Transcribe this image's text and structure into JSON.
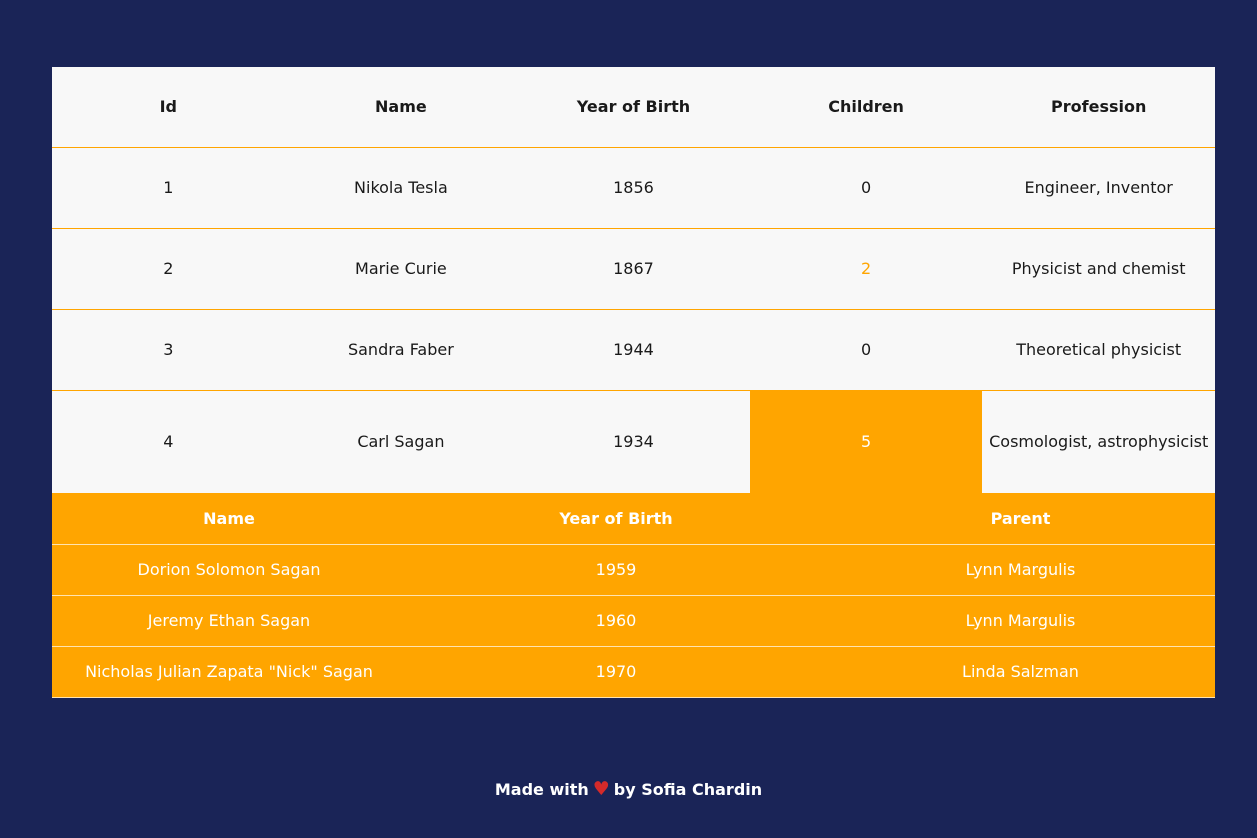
{
  "main_table": {
    "headers": [
      "Id",
      "Name",
      "Year of Birth",
      "Children",
      "Profession"
    ],
    "rows": [
      {
        "id": "1",
        "name": "Nikola Tesla",
        "year": "1856",
        "children": "0",
        "profession": "Engineer, Inventor"
      },
      {
        "id": "2",
        "name": "Marie Curie",
        "year": "1867",
        "children": "2",
        "profession": "Physicist and chemist"
      },
      {
        "id": "3",
        "name": "Sandra Faber",
        "year": "1944",
        "children": "0",
        "profession": "Theoretical physicist"
      },
      {
        "id": "4",
        "name": "Carl Sagan",
        "year": "1934",
        "children": "5",
        "profession": "Cosmologist, astrophysicist"
      }
    ]
  },
  "children_table": {
    "headers": [
      "Name",
      "Year of Birth",
      "Parent"
    ],
    "rows": [
      {
        "name": "Dorion Solomon Sagan",
        "year": "1959",
        "parent": "Lynn Margulis"
      },
      {
        "name": "Jeremy Ethan Sagan",
        "year": "1960",
        "parent": "Lynn Margulis"
      },
      {
        "name": "Nicholas Julian Zapata \"Nick\" Sagan",
        "year": "1970",
        "parent": "Linda Salzman"
      }
    ]
  },
  "footer": {
    "prefix": "Made with",
    "heart": "♥",
    "suffix": "by Sofia Chardin"
  },
  "colors": {
    "background": "#1a2457",
    "accent": "#ffa500",
    "table_bg": "#f8f8f8",
    "heart": "#d42a2a"
  }
}
